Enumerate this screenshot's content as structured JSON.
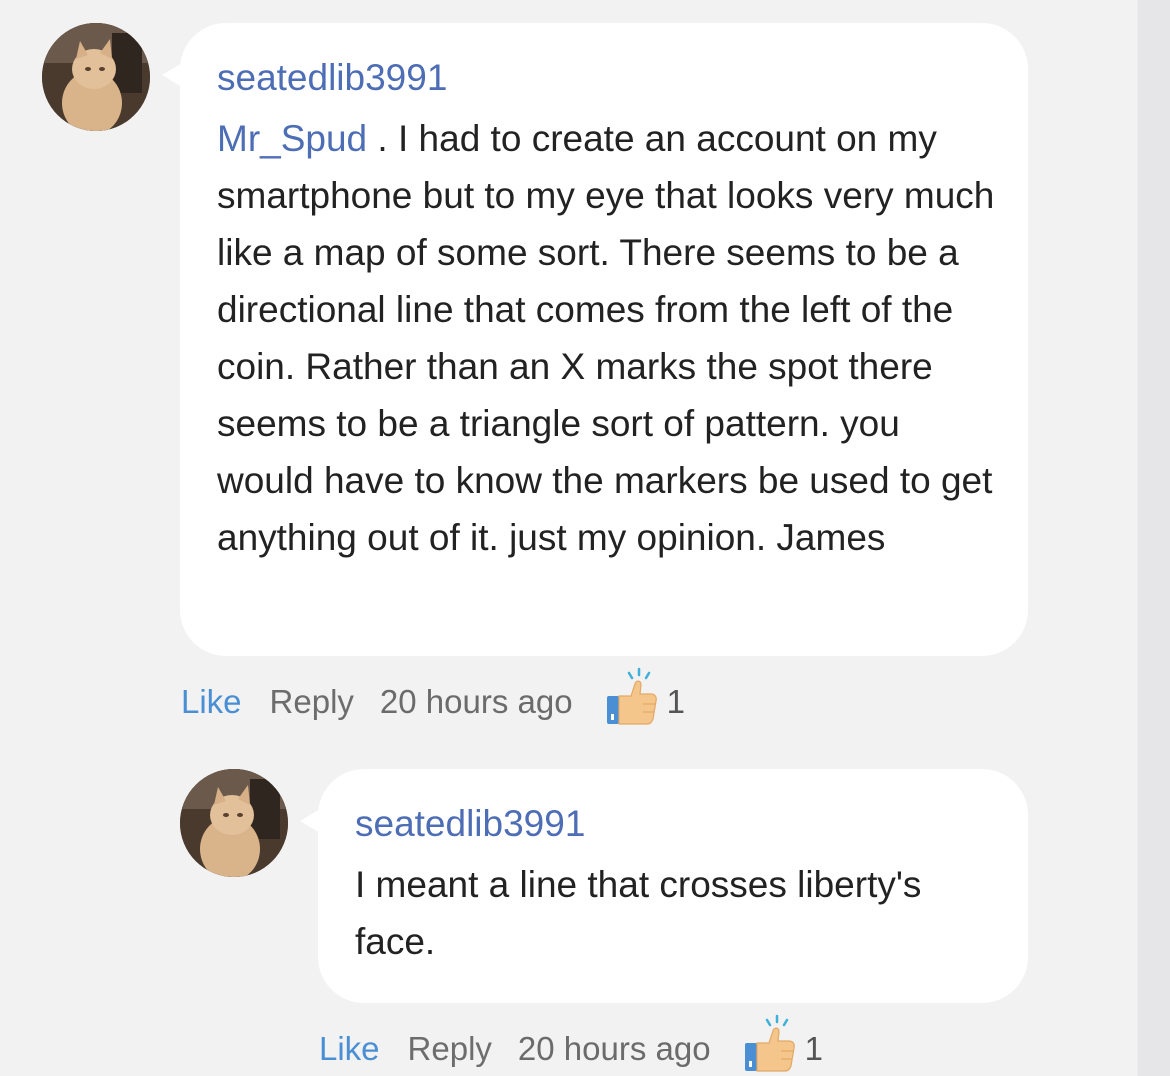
{
  "comments": [
    {
      "username": "seatedlib3991",
      "mention": "Mr_Spud",
      "body": " . I had to create an account on my smartphone but to my eye that looks very much like a map of some sort. There seems to be a directional line that comes from the left of the coin. Rather than an X marks the spot there seems to be a triangle sort of pattern. you would have to know the markers be used to get anything out of it. just my opinion. James",
      "like_label": "Like",
      "reply_label": "Reply",
      "time": "20 hours ago",
      "like_count": "1"
    },
    {
      "username": "seatedlib3991",
      "mention": "",
      "body": "I meant a line that crosses liberty's face.",
      "like_label": "Like",
      "reply_label": "Reply",
      "time": "20 hours ago",
      "like_count": "1"
    }
  ],
  "colors": {
    "username": "#4d6db5",
    "like": "#4a8fd4",
    "background": "#f2f2f3"
  }
}
